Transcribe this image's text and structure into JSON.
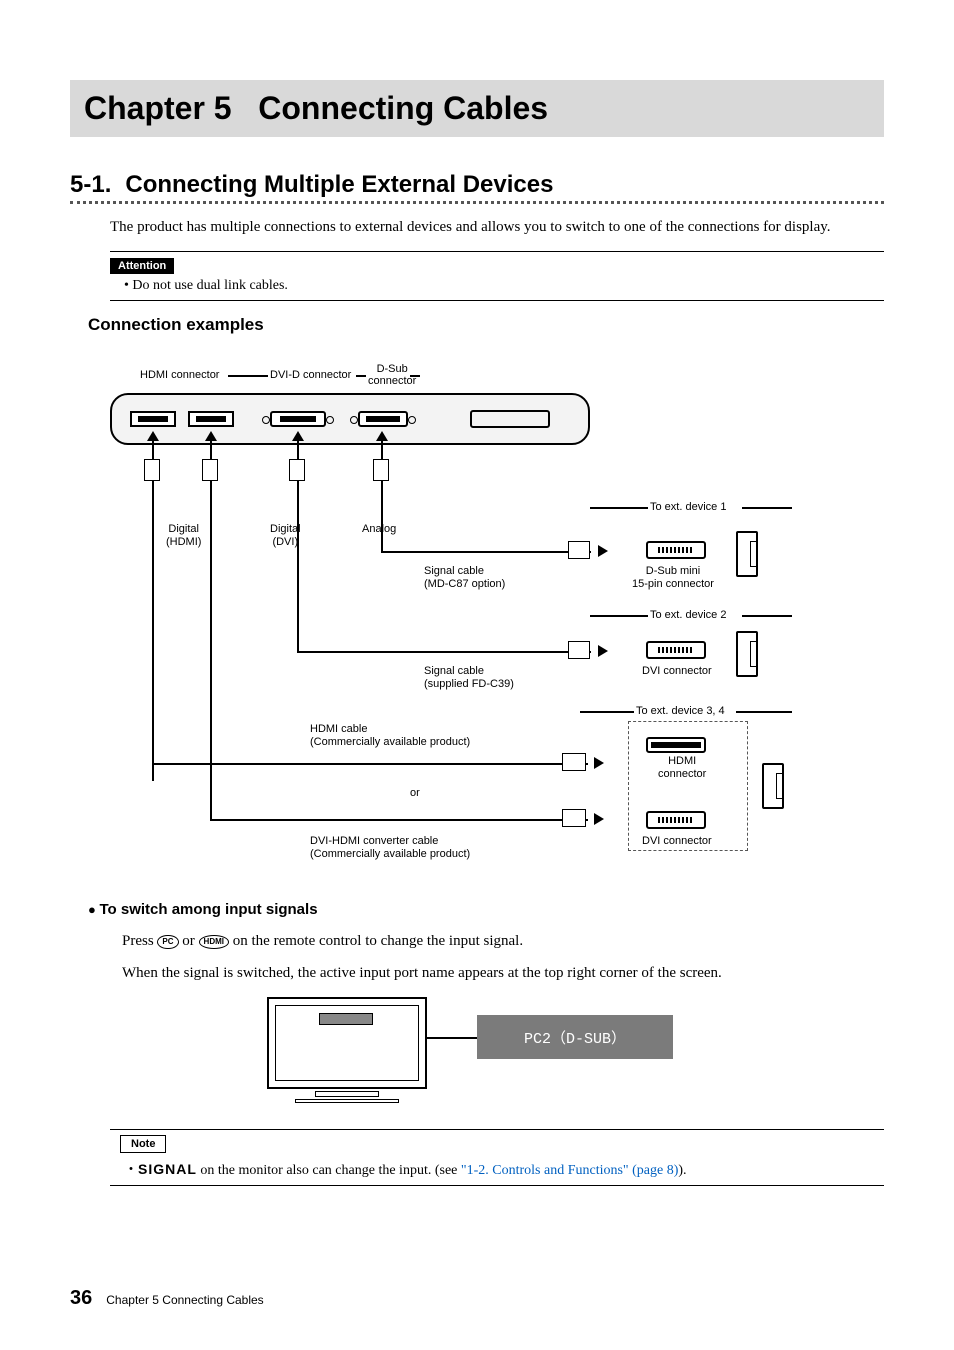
{
  "chapter": {
    "number": "Chapter 5",
    "title": "Connecting Cables"
  },
  "section": {
    "number": "5-1.",
    "title": "Connecting Multiple External Devices"
  },
  "intro": "The product has multiple connections to external devices and allows you to switch to one of the connections for display.",
  "attention": {
    "label": "Attention",
    "bullet": "Do not use dual link cables."
  },
  "examples_heading": "Connection examples",
  "diagram": {
    "ports": {
      "hdmi": "HDMI connector",
      "dvi": "DVI-D connector",
      "dsub": "D-Sub\nconnector"
    },
    "cables": {
      "hdmi": "Digital\n(HDMI)",
      "dvi": "Digital\n(DVI)",
      "analog": "Analog",
      "sig_mdc87": "Signal cable\n(MD-C87 option)",
      "sig_fdc39": "Signal cable\n(supplied FD-C39)",
      "hdmi_cable": "HDMI cable\n(Commercially available product)",
      "or": "or",
      "dvi_hdmi": "DVI-HDMI converter cable\n(Commercially available product)"
    },
    "devices": {
      "d1": "To ext. device 1",
      "d2": "To ext. device 2",
      "d34": "To ext. device 3, 4",
      "dsub_mini": "D-Sub mini\n15-pin connector",
      "dvi_conn": "DVI connector",
      "hdmi_conn": "HDMI\nconnector",
      "dvi_conn2": "DVI connector"
    }
  },
  "switch": {
    "heading": "To switch among input signals",
    "press_prefix": "Press ",
    "pc_btn": "PC",
    "or": " or ",
    "hdmi_btn": "HDMI",
    "press_suffix": " on the remote control to change the input signal.",
    "line2": "When the signal is switched, the active input port name appears at the top right corner of the screen.",
    "osd": "PC2（D-SUB）"
  },
  "note": {
    "label": "Note",
    "signal_word": "SIGNAL",
    "text_prefix": " on the monitor also can change the input. (see ",
    "link": "\"1-2. Controls and Functions\" (page 8)",
    "text_suffix": ")."
  },
  "footer": {
    "page": "36",
    "running": "Chapter 5  Connecting Cables"
  }
}
